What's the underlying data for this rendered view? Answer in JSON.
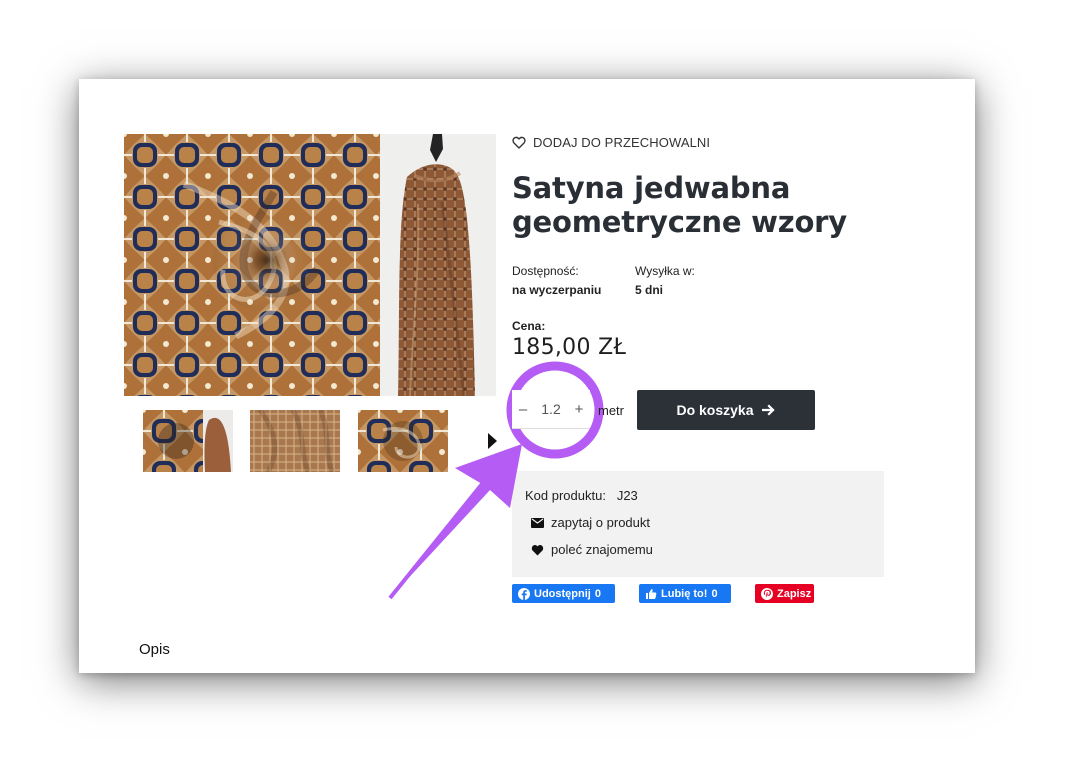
{
  "product": {
    "wishlist_label": "DODAJ DO PRZECHOWALNI",
    "title": "Satyna jedwabna geometryczne wzory",
    "availability_label": "Dostępność:",
    "availability_value": "na wyczerpaniu",
    "shipping_label": "Wysyłka w:",
    "shipping_value": "5 dni",
    "price_label": "Cena:",
    "price": "185,00 ZŁ",
    "quantity_value": "1.2",
    "quantity_minus": "–",
    "quantity_plus": "+",
    "unit_label": "metr",
    "cart_label": "Do koszyka",
    "code_label": "Kod produktu:",
    "code_value": "J23",
    "ask_label": "zapytaj o produkt",
    "recommend_label": "poleć znajomemu",
    "description_tab": "Opis"
  },
  "social": {
    "facebook_share": "Udostępnij",
    "facebook_share_count": "0",
    "facebook_like": "Lubię to!",
    "facebook_like_count": "0",
    "pinterest": "Zapisz"
  },
  "colors": {
    "cart_button": "#2c3138",
    "annotation_purple": "#b45cf3",
    "facebook": "#1877f2",
    "pinterest": "#e60023",
    "fabric_brown": "#b37841",
    "fabric_navy": "#1f2d58"
  },
  "icons": {
    "wishlist": "heart-outline-icon",
    "cart": "arrow-right-icon",
    "ask": "envelope-icon",
    "recommend": "heart-icon",
    "carousel_next": "triangle-right-icon"
  }
}
